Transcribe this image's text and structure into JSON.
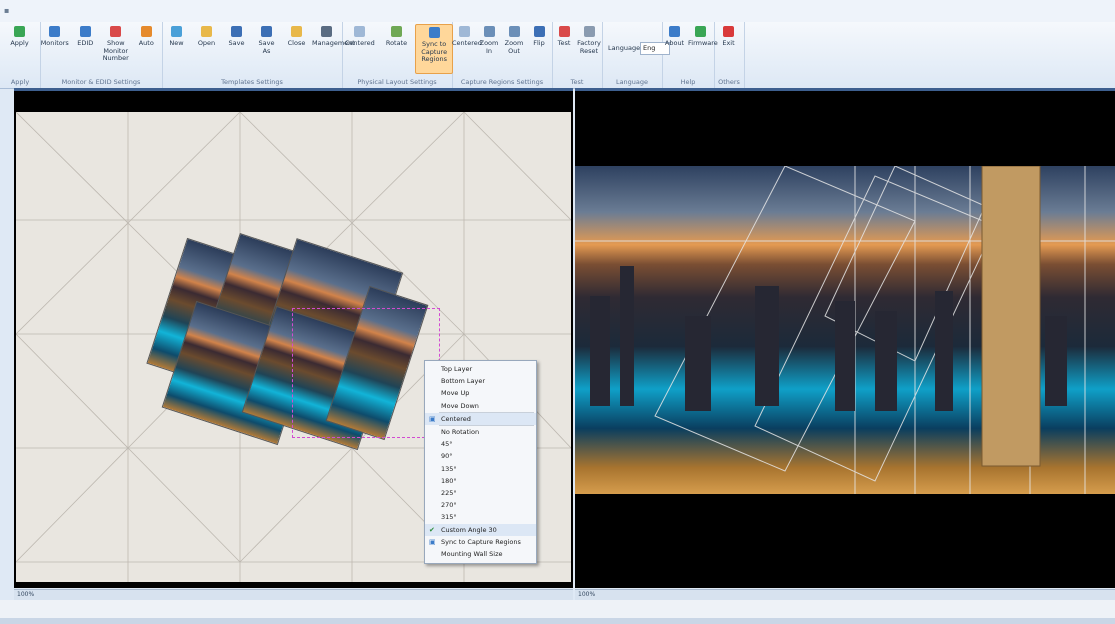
{
  "ribbon": {
    "groups": [
      {
        "label": "Apply",
        "buttons": [
          {
            "label": "Apply",
            "icon": "apply-icon",
            "color": "#3aa655"
          }
        ]
      },
      {
        "label": "Monitor & EDID Settings",
        "buttons": [
          {
            "label": "Monitors",
            "icon": "monitors-icon",
            "color": "#3c7cc9"
          },
          {
            "label": "EDID",
            "icon": "edid-icon",
            "color": "#3c7cc9"
          },
          {
            "label": "Show Monitor\nNumber",
            "icon": "monitor-number-icon",
            "color": "#d94a4a"
          },
          {
            "label": "Auto",
            "icon": "auto-icon",
            "color": "#e58a2c"
          }
        ]
      },
      {
        "label": "Templates Settings",
        "buttons": [
          {
            "label": "New",
            "icon": "new-icon",
            "color": "#4aa0d8"
          },
          {
            "label": "Open",
            "icon": "open-icon",
            "color": "#e8b84a"
          },
          {
            "label": "Save",
            "icon": "save-icon",
            "color": "#3c6fb5"
          },
          {
            "label": "Save\nAs",
            "icon": "save-as-icon",
            "color": "#3c6fb5"
          },
          {
            "label": "Close",
            "icon": "close-icon",
            "color": "#e8b84a"
          },
          {
            "label": "Management",
            "icon": "management-icon",
            "color": "#5a6c82"
          }
        ]
      },
      {
        "label": "Physical Layout Settings",
        "buttons": [
          {
            "label": "Centered",
            "icon": "centered-icon",
            "color": "#9fb8d6"
          },
          {
            "label": "Rotate",
            "icon": "rotate-icon",
            "color": "#6fa855"
          },
          {
            "label": "Sync to Capture\nRegions",
            "icon": "sync-icon",
            "color": "#3c7cc9",
            "active": true
          }
        ]
      },
      {
        "label": "Capture Regions Settings",
        "buttons": [
          {
            "label": "Centered",
            "icon": "centered-region-icon",
            "color": "#9fb8d6"
          },
          {
            "label": "Zoom\nIn",
            "icon": "zoom-in-icon",
            "color": "#6b8fb8"
          },
          {
            "label": "Zoom\nOut",
            "icon": "zoom-out-icon",
            "color": "#6b8fb8"
          },
          {
            "label": "Flip",
            "icon": "flip-icon",
            "color": "#3c6fb5"
          }
        ]
      },
      {
        "label": "Test",
        "buttons": [
          {
            "label": "Test",
            "icon": "test-icon",
            "color": "#d94a4a"
          },
          {
            "label": "Factory\nReset",
            "icon": "factory-reset-icon",
            "color": "#8a9bb0"
          }
        ]
      },
      {
        "label": "Language",
        "language_label": "Language",
        "language_value": "Eng"
      },
      {
        "label": "Help",
        "buttons": [
          {
            "label": "About",
            "icon": "about-icon",
            "color": "#3c7cc9"
          },
          {
            "label": "Firmware",
            "icon": "firmware-icon",
            "color": "#3aa655"
          }
        ]
      },
      {
        "label": "Others",
        "buttons": [
          {
            "label": "Exit",
            "icon": "exit-icon",
            "color": "#d93a3a"
          }
        ]
      }
    ]
  },
  "context_menu": {
    "items": [
      {
        "label": "Top Layer"
      },
      {
        "label": "Bottom Layer"
      },
      {
        "label": "Move Up"
      },
      {
        "label": "Move Down"
      },
      {
        "label": "Centered",
        "separator_before": true,
        "highlighted": true,
        "icon": "centered-menu-icon"
      },
      {
        "label": "No Rotation",
        "separator_before": true
      },
      {
        "label": "45°"
      },
      {
        "label": "90°"
      },
      {
        "label": "135°"
      },
      {
        "label": "180°"
      },
      {
        "label": "225°"
      },
      {
        "label": "270°"
      },
      {
        "label": "315°"
      },
      {
        "label": "Custom Angle 30",
        "checked": true,
        "highlighted": true
      },
      {
        "label": "Sync to Capture Regions",
        "icon": "sync-menu-icon"
      },
      {
        "label": "Mounting Wall Size"
      }
    ]
  },
  "status": {
    "left_zoom": "100%",
    "right_zoom": "100%"
  },
  "colors": {
    "accent": "#ffd79a",
    "ribbon": "#dde8f5",
    "selection": "#d24bd2"
  }
}
